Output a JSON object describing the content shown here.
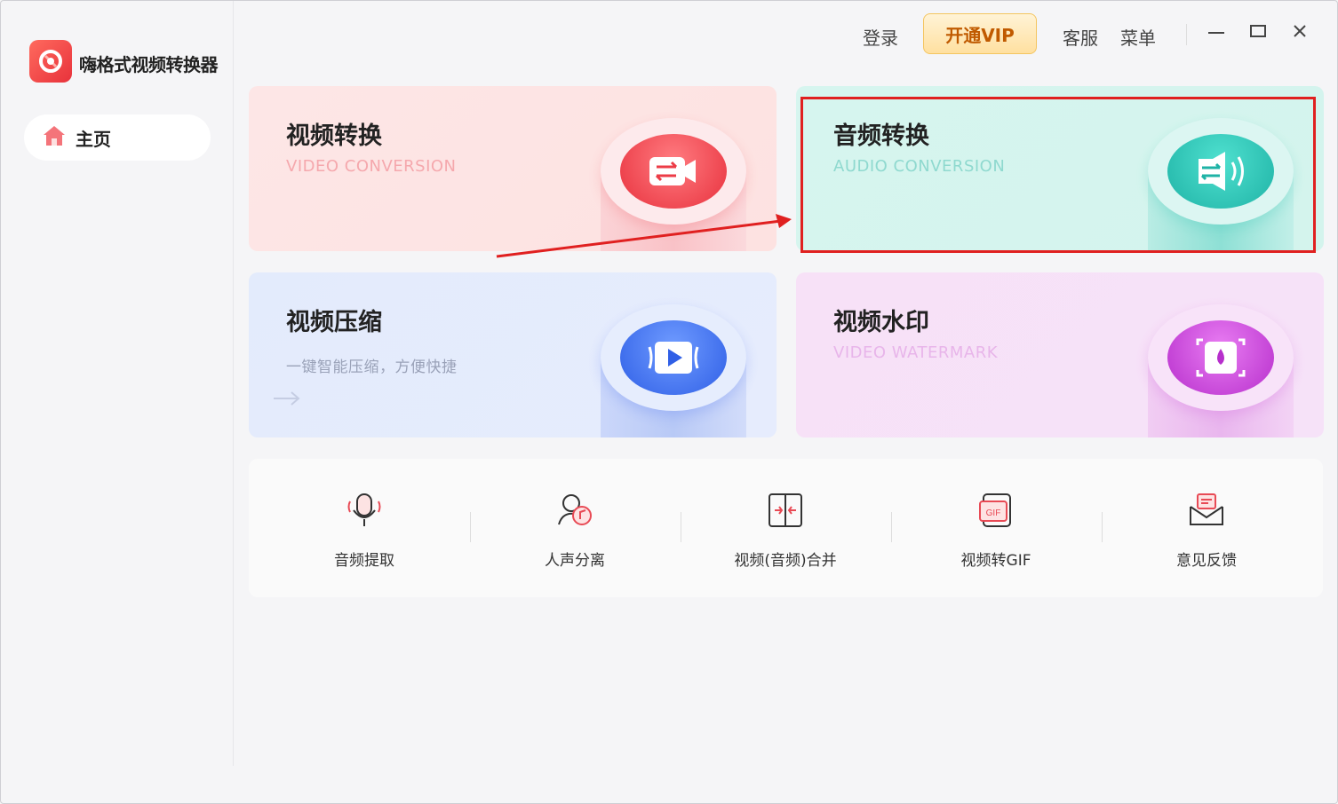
{
  "app": {
    "title": "嗨格式视频转换器"
  },
  "sidebar": {
    "items": [
      {
        "label": "主页",
        "icon": "home-icon",
        "active": true
      }
    ]
  },
  "topbar": {
    "login": "登录",
    "vip": "开通VIP",
    "support": "客服",
    "menu": "菜单"
  },
  "cards": [
    {
      "title": "视频转换",
      "subtitle": "VIDEO CONVERSION",
      "icon": "video-convert-icon",
      "accent": "#f0454f"
    },
    {
      "title": "音频转换",
      "subtitle": "AUDIO CONVERSION",
      "icon": "audio-convert-icon",
      "accent": "#22c3b3",
      "highlighted": true
    },
    {
      "title": "视频压缩",
      "subtitle": "一键智能压缩，方便快捷",
      "icon": "video-compress-icon",
      "accent": "#3f6ff0"
    },
    {
      "title": "视频水印",
      "subtitle": "VIDEO WATERMARK",
      "icon": "video-watermark-icon",
      "accent": "#c94ad8"
    }
  ],
  "tools": [
    {
      "label": "音频提取",
      "icon": "microphone-icon"
    },
    {
      "label": "人声分离",
      "icon": "voice-separate-icon"
    },
    {
      "label": "视频(音频)合并",
      "icon": "merge-icon"
    },
    {
      "label": "视频转GIF",
      "icon": "gif-icon"
    },
    {
      "label": "意见反馈",
      "icon": "feedback-mail-icon"
    }
  ],
  "colors": {
    "accent_red": "#e02020",
    "vip_text": "#c05a00"
  }
}
